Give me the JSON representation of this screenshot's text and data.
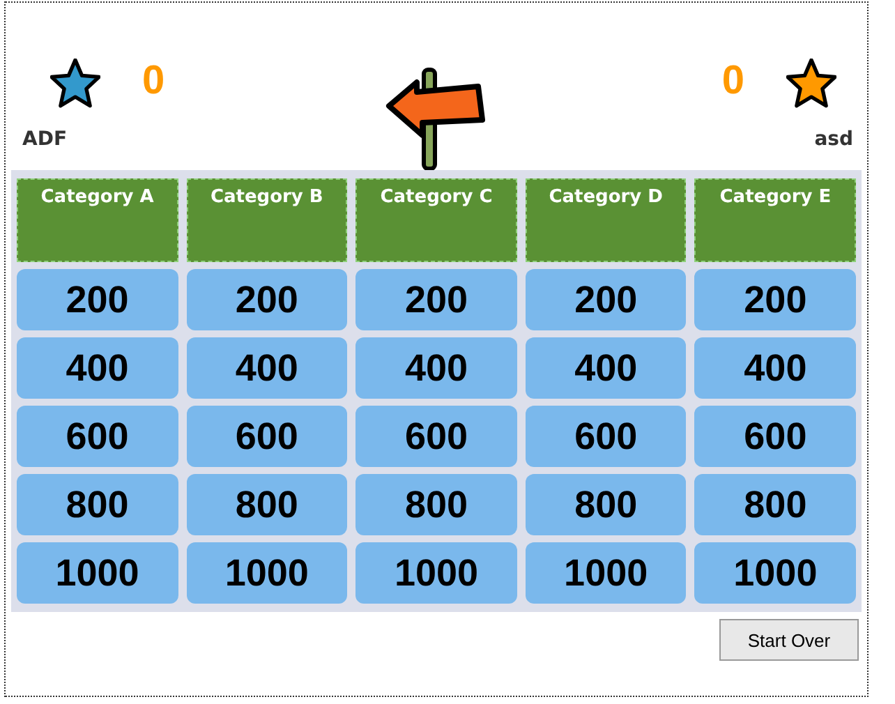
{
  "players": [
    {
      "name": "ADF",
      "score": "0",
      "color": "#3399cc"
    },
    {
      "name": "asd",
      "score": "0",
      "color": "#ff9900"
    }
  ],
  "categories": [
    {
      "title": "Category A",
      "clues": [
        "200",
        "400",
        "600",
        "800",
        "1000"
      ]
    },
    {
      "title": "Category B",
      "clues": [
        "200",
        "400",
        "600",
        "800",
        "1000"
      ]
    },
    {
      "title": "Category C",
      "clues": [
        "200",
        "400",
        "600",
        "800",
        "1000"
      ]
    },
    {
      "title": "Category D",
      "clues": [
        "200",
        "400",
        "600",
        "800",
        "1000"
      ]
    },
    {
      "title": "Category E",
      "clues": [
        "200",
        "400",
        "600",
        "800",
        "1000"
      ]
    }
  ],
  "buttons": [
    "Start Over"
  ]
}
